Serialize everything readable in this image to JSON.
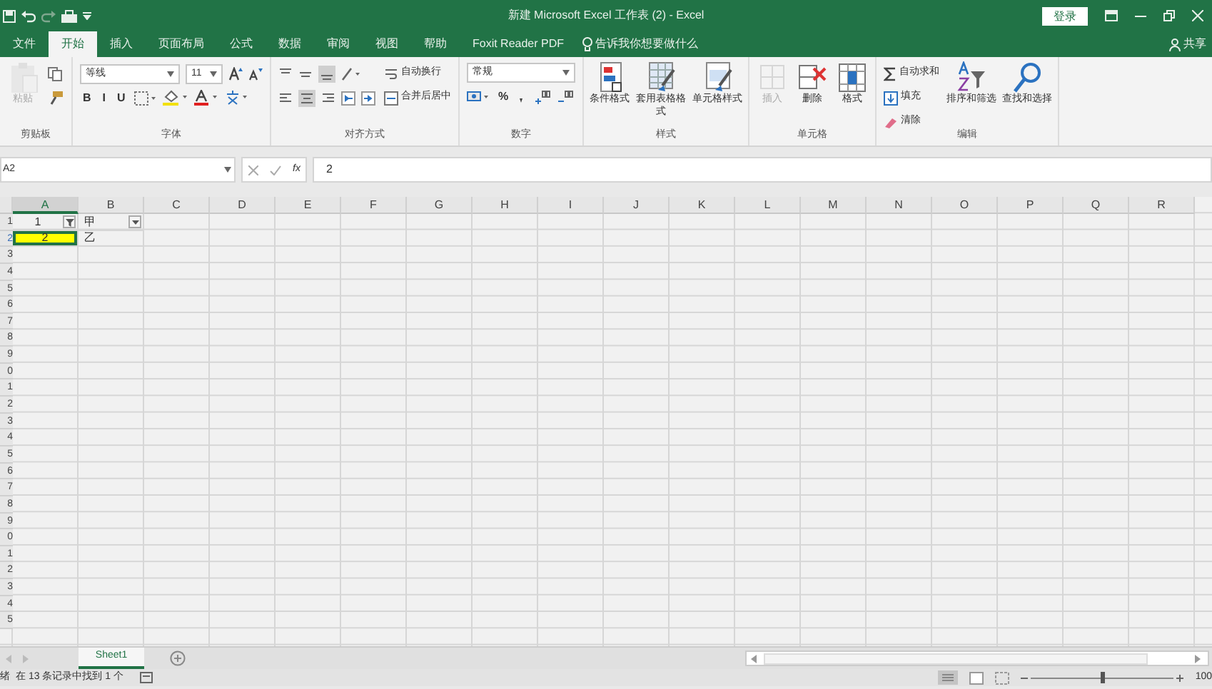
{
  "window": {
    "title": "新建 Microsoft Excel 工作表 (2) - Excel",
    "login": "登录",
    "share": "共享"
  },
  "tabs": [
    {
      "label": "文件",
      "selected": false
    },
    {
      "label": "开始",
      "selected": true
    },
    {
      "label": "插入",
      "selected": false
    },
    {
      "label": "页面布局",
      "selected": false
    },
    {
      "label": "公式",
      "selected": false
    },
    {
      "label": "数据",
      "selected": false
    },
    {
      "label": "审阅",
      "selected": false
    },
    {
      "label": "视图",
      "selected": false
    },
    {
      "label": "帮助",
      "selected": false
    },
    {
      "label": "Foxit Reader PDF",
      "selected": false
    }
  ],
  "tell_me": "告诉我你想要做什么",
  "ribbon": [
    {
      "label": "剪贴板",
      "columns": [
        [
          [
            {
              "kind": "big",
              "label": "粘贴",
              "disabled": true
            }
          ]
        ],
        [
          [
            {
              "kind": "icon"
            }
          ],
          [
            {
              "kind": "icon"
            }
          ]
        ]
      ]
    },
    {
      "label": "字体",
      "columns": [
        [
          [
            {
              "kind": "field",
              "value": "等线"
            },
            {
              "kind": "field",
              "value": "11"
            },
            {
              "kind": "icon"
            },
            {
              "kind": "icon"
            }
          ],
          [
            {
              "kind": "glyph",
              "text": "B"
            },
            {
              "kind": "glyph",
              "text": "I"
            },
            {
              "kind": "glyph",
              "text": "U"
            },
            {
              "kind": "icon"
            },
            {
              "kind": "icon"
            },
            {
              "kind": "icon"
            },
            {
              "kind": "icon"
            }
          ]
        ]
      ]
    },
    {
      "label": "对齐方式",
      "columns": [
        [
          [
            {
              "kind": "icon"
            },
            {
              "kind": "icon"
            },
            {
              "kind": "icon"
            },
            {
              "kind": "icon"
            }
          ],
          [
            {
              "kind": "icon"
            },
            {
              "kind": "icon"
            },
            {
              "kind": "icon"
            },
            {
              "kind": "icon"
            },
            {
              "kind": "icon"
            }
          ]
        ],
        [
          [
            {
              "kind": "small",
              "label": "自动换行"
            }
          ],
          [
            {
              "kind": "small",
              "label": "合并后居中"
            }
          ]
        ]
      ]
    },
    {
      "label": "数字",
      "columns": [
        [
          [
            {
              "kind": "field",
              "value": "常规"
            }
          ],
          [
            {
              "kind": "icon"
            },
            {
              "kind": "glyph",
              "text": "%"
            },
            {
              "kind": "icon"
            },
            {
              "kind": "icon"
            },
            {
              "kind": "icon"
            }
          ]
        ]
      ]
    },
    {
      "label": "样式",
      "columns": [
        [
          [
            {
              "kind": "big",
              "label": "条件格式",
              "disabled": false
            }
          ]
        ],
        [
          [
            {
              "kind": "big",
              "label": "套用表格格式",
              "disabled": false
            }
          ]
        ],
        [
          [
            {
              "kind": "big",
              "label": "单元格样式",
              "disabled": false
            }
          ]
        ]
      ]
    },
    {
      "label": "单元格",
      "columns": [
        [
          [
            {
              "kind": "big",
              "label": "插入",
              "disabled": true
            }
          ]
        ],
        [
          [
            {
              "kind": "big",
              "label": "删除",
              "disabled": false
            }
          ]
        ],
        [
          [
            {
              "kind": "big",
              "label": "格式",
              "disabled": false
            }
          ]
        ]
      ]
    },
    {
      "label": "编辑",
      "columns": [
        [
          [
            {
              "kind": "small",
              "label": "自动求和"
            }
          ],
          [
            {
              "kind": "small",
              "label": "填充"
            }
          ],
          [
            {
              "kind": "small",
              "label": "清除"
            }
          ]
        ],
        [
          [
            {
              "kind": "big",
              "label": "排序和筛选",
              "disabled": false
            }
          ]
        ],
        [
          [
            {
              "kind": "big",
              "label": "查找和选择",
              "disabled": false
            }
          ]
        ]
      ]
    }
  ],
  "formula_bar": {
    "name_box": "A2",
    "function_button": "fx",
    "value": "2"
  },
  "columns": [
    {
      "label": "A",
      "selected": true
    },
    {
      "label": "B",
      "selected": false
    },
    {
      "label": "C",
      "selected": false
    },
    {
      "label": "D",
      "selected": false
    },
    {
      "label": "E",
      "selected": false
    },
    {
      "label": "F",
      "selected": false
    },
    {
      "label": "G",
      "selected": false
    },
    {
      "label": "H",
      "selected": false
    },
    {
      "label": "I",
      "selected": false
    },
    {
      "label": "J",
      "selected": false
    },
    {
      "label": "K",
      "selected": false
    },
    {
      "label": "L",
      "selected": false
    },
    {
      "label": "M",
      "selected": false
    },
    {
      "label": "N",
      "selected": false
    },
    {
      "label": "O",
      "selected": false
    },
    {
      "label": "P",
      "selected": false
    },
    {
      "label": "Q",
      "selected": false
    },
    {
      "label": "R",
      "selected": false
    }
  ],
  "rows": [
    {
      "header": "1",
      "selected": false,
      "cells": [
        {
          "text": "1",
          "selected": false,
          "highlighted": false,
          "filter": true
        },
        {
          "text": "甲",
          "selected": false,
          "highlighted": false,
          "filter": true
        }
      ]
    },
    {
      "header": "2",
      "selected": true,
      "cells": [
        {
          "text": "2",
          "selected": true,
          "highlighted": true,
          "filter": false
        },
        {
          "text": "乙",
          "selected": false,
          "highlighted": false,
          "filter": false
        }
      ]
    },
    {
      "header": "3"
    },
    {
      "header": "4"
    },
    {
      "header": "5"
    },
    {
      "header": "6"
    },
    {
      "header": "7"
    },
    {
      "header": "8"
    },
    {
      "header": "9"
    },
    {
      "header": "0"
    },
    {
      "header": "1"
    },
    {
      "header": "2"
    },
    {
      "header": "3"
    },
    {
      "header": "4"
    },
    {
      "header": "5"
    },
    {
      "header": "6"
    },
    {
      "header": "7"
    },
    {
      "header": "8"
    },
    {
      "header": "9"
    },
    {
      "header": "0"
    },
    {
      "header": "1"
    },
    {
      "header": "2"
    },
    {
      "header": "3"
    },
    {
      "header": "4"
    },
    {
      "header": "5"
    }
  ],
  "sheets": [
    {
      "label": "Sheet1",
      "selected": true
    }
  ],
  "status_bar": {
    "mode": "绪",
    "message": "在 13 条记录中找到 1 个",
    "zoom": "100",
    "zoom_slider": {
      "level": 0.5
    }
  }
}
